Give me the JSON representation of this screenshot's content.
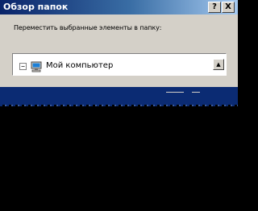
{
  "window": {
    "title": "Обзор папок",
    "help_label": "?",
    "close_label": "X"
  },
  "dialog": {
    "instruction": "Переместить выбранные элементы в папку:"
  },
  "tree": {
    "root": {
      "expander": "−",
      "icon": "computer-icon",
      "label": "Мой компьютер"
    },
    "scroll_up_glyph": "▲"
  },
  "colors": {
    "title_bar": "#0a246a",
    "face": "#d4d0c8",
    "selection": "#0b2b73",
    "background": "#000000"
  }
}
